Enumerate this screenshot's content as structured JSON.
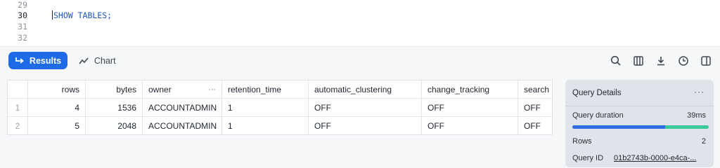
{
  "editor": {
    "lines": [
      {
        "num": "29",
        "code": ""
      },
      {
        "num": "30",
        "code": "SHOW TABLES;"
      },
      {
        "num": "31",
        "code": ""
      },
      {
        "num": "32",
        "code": ""
      }
    ]
  },
  "toolbar": {
    "results_label": "Results",
    "chart_label": "Chart",
    "icons": [
      "search-icon",
      "columns-icon",
      "download-icon",
      "history-icon",
      "split-panel-icon"
    ]
  },
  "table": {
    "columns": [
      "",
      "rows",
      "bytes",
      "owner",
      "retention_time",
      "automatic_clustering",
      "change_tracking",
      "search"
    ],
    "owner_menu": "···",
    "rows": [
      [
        "1",
        "4",
        "1536",
        "ACCOUNTADMIN",
        "1",
        "OFF",
        "OFF",
        "OFF"
      ],
      [
        "2",
        "5",
        "2048",
        "ACCOUNTADMIN",
        "1",
        "OFF",
        "OFF",
        "OFF"
      ]
    ]
  },
  "query_details": {
    "title": "Query Details",
    "more": "···",
    "duration_label": "Query duration",
    "duration_value": "39ms",
    "duration_bar_fraction": 0.68,
    "rows_label": "Rows",
    "rows_value": "2",
    "id_label": "Query ID",
    "id_value": "01b2743b-0000-e4ca-..."
  },
  "colors": {
    "accent": "#1f6ae6",
    "bar_primary": "#2f6ee0",
    "bar_secondary": "#3ec99a"
  }
}
